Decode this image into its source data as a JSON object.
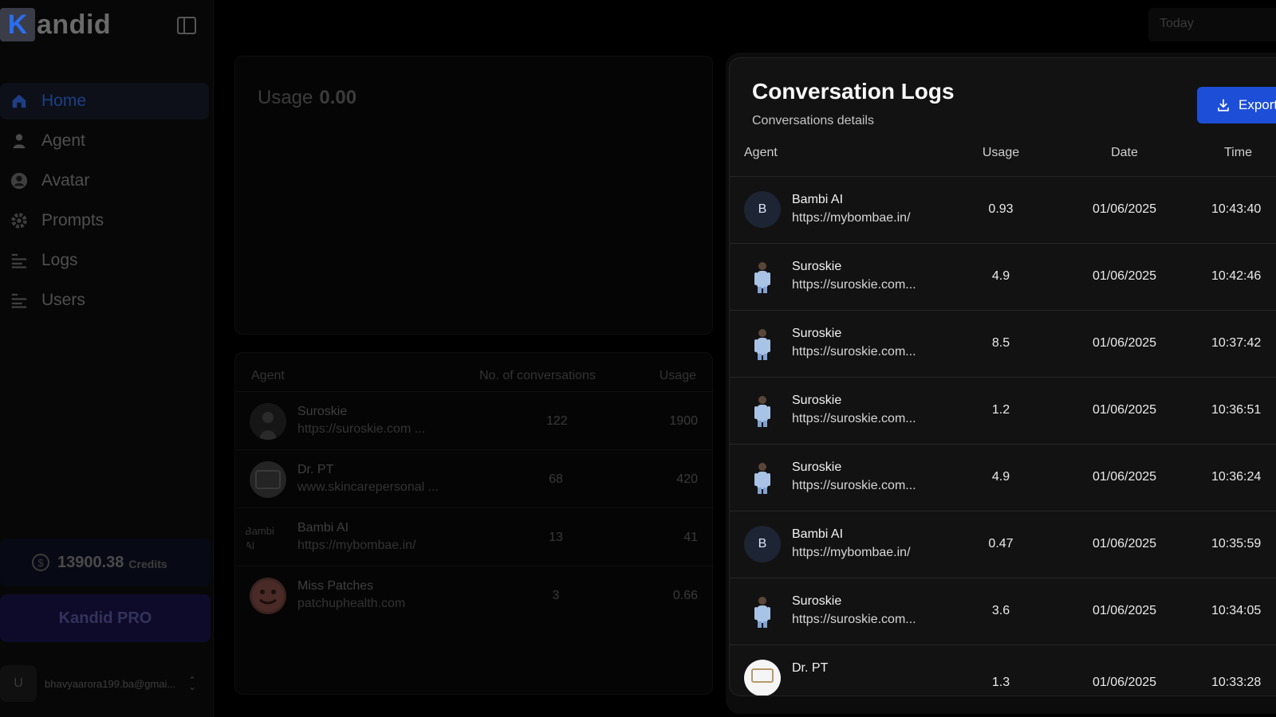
{
  "sidebar": {
    "logo_letter": "K",
    "logo_rest": "andid",
    "nav": [
      {
        "label": "Home",
        "icon": "home-icon",
        "active": true
      },
      {
        "label": "Agent",
        "icon": "user-icon"
      },
      {
        "label": "Avatar",
        "icon": "avatar-icon"
      },
      {
        "label": "Prompts",
        "icon": "settings-icon"
      },
      {
        "label": "Logs",
        "icon": "list-icon"
      },
      {
        "label": "Users",
        "icon": "list-icon"
      }
    ],
    "credits_amount": "13900.38",
    "credits_label": "Credits",
    "pro_label": "Kandid PRO",
    "user_initial": "U",
    "user_email": "bhavyaarora199.ba@gmai..."
  },
  "date_filter": "Today",
  "usage_card": {
    "label": "Usage",
    "value": "0.00"
  },
  "agents_table": {
    "headers": {
      "agent": "Agent",
      "conversations": "No. of conversations",
      "usage": "Usage"
    },
    "rows": [
      {
        "name": "Suroskie",
        "url": "https://suroskie.com ...",
        "conversations": "122",
        "usage": "1900"
      },
      {
        "name": "Dr. PT",
        "url": "www.skincarepersonal ...",
        "conversations": "68",
        "usage": "420"
      },
      {
        "name": "Bambi AI",
        "url": "https://mybombae.in/",
        "conversations": "13",
        "usage": "41",
        "avatar_text": "Bambi AI"
      },
      {
        "name": "Miss Patches",
        "url": "patchuphealth.com",
        "conversations": "3",
        "usage": "0.66"
      }
    ]
  },
  "modal": {
    "title": "Conversation Logs",
    "subtitle": "Conversations details",
    "export_label": "Export",
    "headers": {
      "agent": "Agent",
      "usage": "Usage",
      "date": "Date",
      "time": "Time"
    },
    "rows": [
      {
        "type": "letter",
        "avatar": "B",
        "name": "Bambi AI",
        "url": "https://mybombae.in/",
        "usage": "0.93",
        "date": "01/06/2025",
        "time": "10:43:40"
      },
      {
        "type": "person",
        "name": "Suroskie",
        "url": "https://suroskie.com...",
        "usage": "4.9",
        "date": "01/06/2025",
        "time": "10:42:46"
      },
      {
        "type": "person",
        "name": "Suroskie",
        "url": "https://suroskie.com...",
        "usage": "8.5",
        "date": "01/06/2025",
        "time": "10:37:42"
      },
      {
        "type": "person",
        "name": "Suroskie",
        "url": "https://suroskie.com...",
        "usage": "1.2",
        "date": "01/06/2025",
        "time": "10:36:51"
      },
      {
        "type": "person",
        "name": "Suroskie",
        "url": "https://suroskie.com...",
        "usage": "4.9",
        "date": "01/06/2025",
        "time": "10:36:24"
      },
      {
        "type": "letter",
        "avatar": "B",
        "name": "Bambi AI",
        "url": "https://mybombae.in/",
        "usage": "0.47",
        "date": "01/06/2025",
        "time": "10:35:59"
      },
      {
        "type": "person",
        "name": "Suroskie",
        "url": "https://suroskie.com...",
        "usage": "3.6",
        "date": "01/06/2025",
        "time": "10:34:05"
      },
      {
        "type": "drpt",
        "name": "Dr. PT",
        "url": "",
        "usage": "1.3",
        "date": "01/06/2025",
        "time": "10:33:28"
      }
    ]
  },
  "colors": {
    "accent": "#1d4ed8",
    "background": "#000000",
    "modal": "#121212"
  }
}
